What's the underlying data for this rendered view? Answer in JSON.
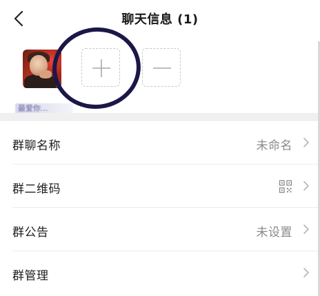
{
  "header": {
    "title": "聊天信息 (1)"
  },
  "members": {
    "items": [
      {
        "name": "最爱你..."
      }
    ]
  },
  "settings": {
    "rows": [
      {
        "label": "群聊名称",
        "value": "未命名"
      },
      {
        "label": "群二维码",
        "value": ""
      },
      {
        "label": "群公告",
        "value": "未设置"
      },
      {
        "label": "群管理",
        "value": ""
      }
    ]
  },
  "colors": {
    "highlight_ring": "#1b1748",
    "divider": "#f0f0f0",
    "secondary_text": "#8a8a8a"
  },
  "icons": {
    "back": "chevron-left-icon",
    "add": "plus-icon",
    "remove": "minus-icon",
    "qr": "qr-code-icon",
    "chevron": "chevron-right-icon"
  }
}
